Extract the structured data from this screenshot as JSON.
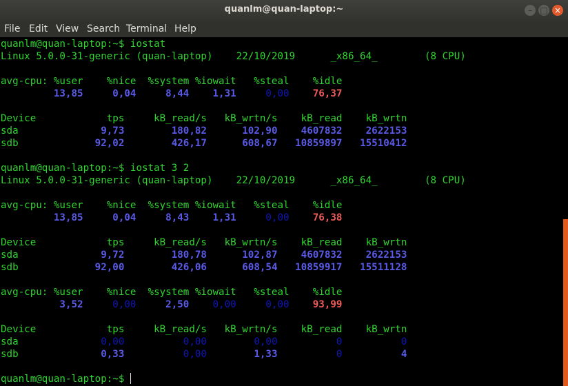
{
  "window": {
    "title": "quanlm@quan-laptop:~"
  },
  "menu": [
    "File",
    "Edit",
    "View",
    "Search",
    "Terminal",
    "Help"
  ],
  "terminal": {
    "prompt": "quanlm@quan-laptop:~$",
    "cmd1": "iostat",
    "cmd2": "iostat 3 2",
    "sysinfo": [
      "Linux 5.0.0-31-generic (quan-laptop)",
      "22/10/2019",
      "_x86_64_",
      "(8 CPU)"
    ],
    "cpu_header": [
      "avg-cpu:",
      "%user",
      "%nice",
      "%system",
      "%iowait",
      "%steal",
      "%idle"
    ],
    "dev_header": [
      "Device",
      "tps",
      "kB_read/s",
      "kB_wrtn/s",
      "kB_read",
      "kB_wrtn"
    ],
    "block1": {
      "cpu": [
        "13,85",
        "0,04",
        "8,44",
        "1,31",
        "0,00",
        "76,37"
      ],
      "sda": [
        "sda",
        "9,73",
        "180,82",
        "102,90",
        "4607832",
        "2622153"
      ],
      "sdb": [
        "sdb",
        "92,02",
        "426,17",
        "608,67",
        "10859897",
        "15510412"
      ]
    },
    "block2": {
      "cpu": [
        "13,85",
        "0,04",
        "8,43",
        "1,31",
        "0,00",
        "76,38"
      ],
      "sda": [
        "sda",
        "9,72",
        "180,78",
        "102,87",
        "4607832",
        "2622153"
      ],
      "sdb": [
        "sdb",
        "92,00",
        "426,06",
        "608,54",
        "10859917",
        "15511128"
      ]
    },
    "block3": {
      "cpu": [
        "3,52",
        "0,00",
        "2,50",
        "0,00",
        "0,00",
        "93,99"
      ],
      "sda": [
        "sda",
        "0,00",
        "0,00",
        "0,00",
        "0",
        "0"
      ],
      "sdb": [
        "sdb",
        "0,33",
        "0,00",
        "1,33",
        "0",
        "4"
      ]
    }
  },
  "colors": {
    "green": "#31d531",
    "blue": "#5a5ae8",
    "dim_blue": "#0f16b6",
    "red": "#ef5a5a",
    "scrollbar": "#e4581d"
  }
}
